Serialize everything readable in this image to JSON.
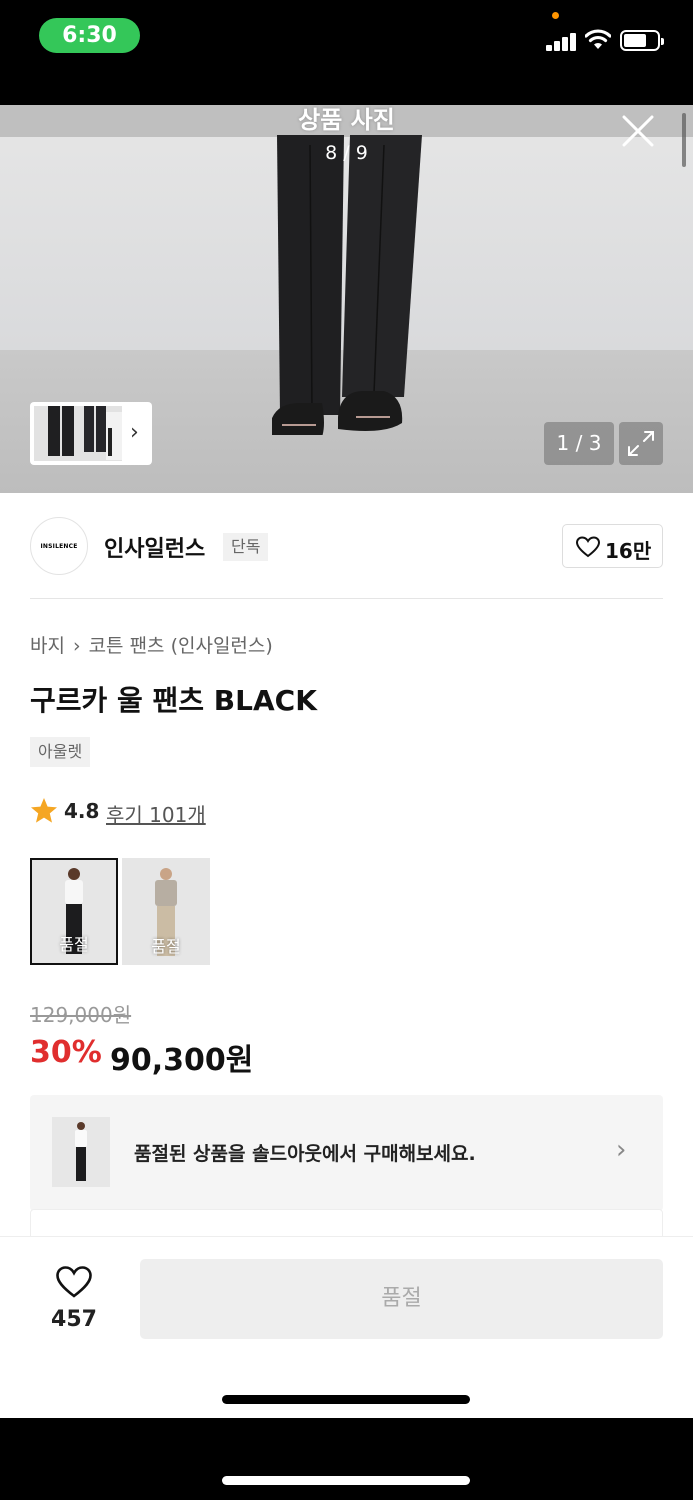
{
  "status_bar": {
    "time": "6:30"
  },
  "viewer": {
    "title": "상품 사진",
    "counter": "8 / 9",
    "page_indicator": "1 / 3"
  },
  "brand": {
    "logo_text": "INSILENCE",
    "name": "인사일런스",
    "badge": "단독",
    "like_count": "16만"
  },
  "breadcrumb": {
    "category": "바지",
    "sub_category": "코튼 팬츠 (인사일런스)"
  },
  "product": {
    "title": "구르카 울 팬츠 BLACK",
    "outlet_badge": "아울렛",
    "rating": "4.8",
    "reviews": "후기 101개",
    "colors": [
      {
        "name": "black",
        "status": "품절"
      },
      {
        "name": "beige",
        "status": "품절"
      }
    ],
    "original_price": "129,000원",
    "discount": "30%",
    "sale_price": "90,300원"
  },
  "soldout_banner": {
    "text": "품절된 상품을 솔드아웃에서 구매해보세요."
  },
  "bottom_bar": {
    "wish_count": "457",
    "buy_button_label": "품절"
  },
  "colors": {
    "accent_red": "#e02e2e",
    "status_green": "#34c759"
  }
}
